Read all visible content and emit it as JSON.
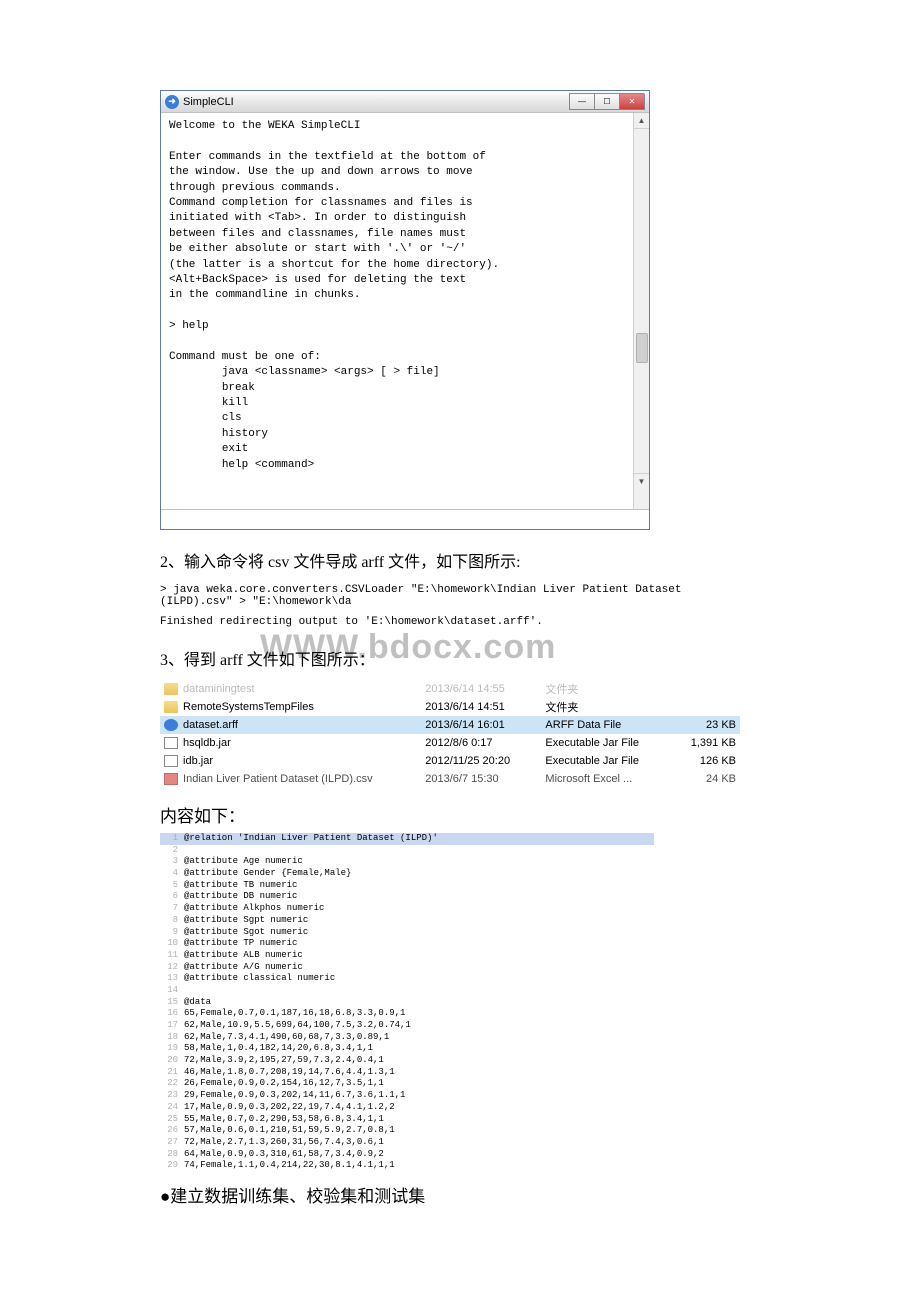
{
  "cli": {
    "title": "SimpleCLI",
    "body": "Welcome to the WEKA SimpleCLI\n\nEnter commands in the textfield at the bottom of\nthe window. Use the up and down arrows to move\nthrough previous commands.\nCommand completion for classnames and files is\ninitiated with <Tab>. In order to distinguish\nbetween files and classnames, file names must\nbe either absolute or start with '.\\' or '~/'\n(the latter is a shortcut for the home directory).\n<Alt+BackSpace> is used for deleting the text\nin the commandline in chunks.\n\n> help\n\nCommand must be one of:\n        java <classname> <args> [ > file]\n        break\n        kill\n        cls\n        history\n        exit\n        help <command>\n"
  },
  "step2": "2、输入命令将 csv 文件导成 arff 文件，如下图所示:",
  "cmd": "> java weka.core.converters.CSVLoader \"E:\\homework\\Indian Liver Patient Dataset (ILPD).csv\" > \"E:\\homework\\da",
  "finished": "Finished redirecting output to 'E:\\homework\\dataset.arff'.",
  "watermark": "WWW.bdocx.com",
  "step3": "3、得到 arff 文件如下图所示：",
  "files": {
    "rows": [
      {
        "icon": "folder",
        "name": "dataminingtest",
        "date": "2013/6/14 14:55",
        "type": "文件夹",
        "size": "",
        "cut": true
      },
      {
        "icon": "folder",
        "name": "RemoteSystemsTempFiles",
        "date": "2013/6/14 14:51",
        "type": "文件夹",
        "size": ""
      },
      {
        "icon": "weka",
        "name": "dataset.arff",
        "date": "2013/6/14 16:01",
        "type": "ARFF Data File",
        "size": "23 KB",
        "selected": true
      },
      {
        "icon": "jar",
        "name": "hsqldb.jar",
        "date": "2012/8/6 0:17",
        "type": "Executable Jar File",
        "size": "1,391 KB"
      },
      {
        "icon": "jar",
        "name": "idb.jar",
        "date": "2012/11/25 20:20",
        "type": "Executable Jar File",
        "size": "126 KB"
      },
      {
        "icon": "excel",
        "name": "Indian Liver Patient Dataset (ILPD).csv",
        "date": "2013/6/7 15:30",
        "type": "Microsoft Excel ...",
        "size": "24 KB",
        "cutbottom": true
      }
    ]
  },
  "contentHeading": "内容如下：",
  "arff": [
    "@relation 'Indian Liver Patient Dataset (ILPD)'",
    "",
    "@attribute Age numeric",
    "@attribute Gender {Female,Male}",
    "@attribute TB numeric",
    "@attribute DB numeric",
    "@attribute Alkphos numeric",
    "@attribute Sgpt numeric",
    "@attribute Sgot numeric",
    "@attribute TP numeric",
    "@attribute ALB numeric",
    "@attribute A/G numeric",
    "@attribute classical numeric",
    "",
    "@data",
    "65,Female,0.7,0.1,187,16,18,6.8,3.3,0.9,1",
    "62,Male,10.9,5.5,699,64,100,7.5,3.2,0.74,1",
    "62,Male,7.3,4.1,490,60,68,7,3.3,0.89,1",
    "58,Male,1,0.4,182,14,20,6.8,3.4,1,1",
    "72,Male,3.9,2,195,27,59,7.3,2.4,0.4,1",
    "46,Male,1.8,0.7,208,19,14,7.6,4.4,1.3,1",
    "26,Female,0.9,0.2,154,16,12,7,3.5,1,1",
    "29,Female,0.9,0.3,202,14,11,6.7,3.6,1.1,1",
    "17,Male,0.9,0.3,202,22,19,7.4,4.1,1.2,2",
    "55,Male,0.7,0.2,290,53,58,6.8,3.4,1,1",
    "57,Male,0.6,0.1,210,51,59,5.9,2.7,0.8,1",
    "72,Male,2.7,1.3,260,31,56,7.4,3,0.6,1",
    "64,Male,0.9,0.3,310,61,58,7,3.4,0.9,2",
    "74,Female,1.1,0.4,214,22,30,8.1,4.1,1,1"
  ],
  "bullet": "●建立数据训练集、校验集和测试集"
}
